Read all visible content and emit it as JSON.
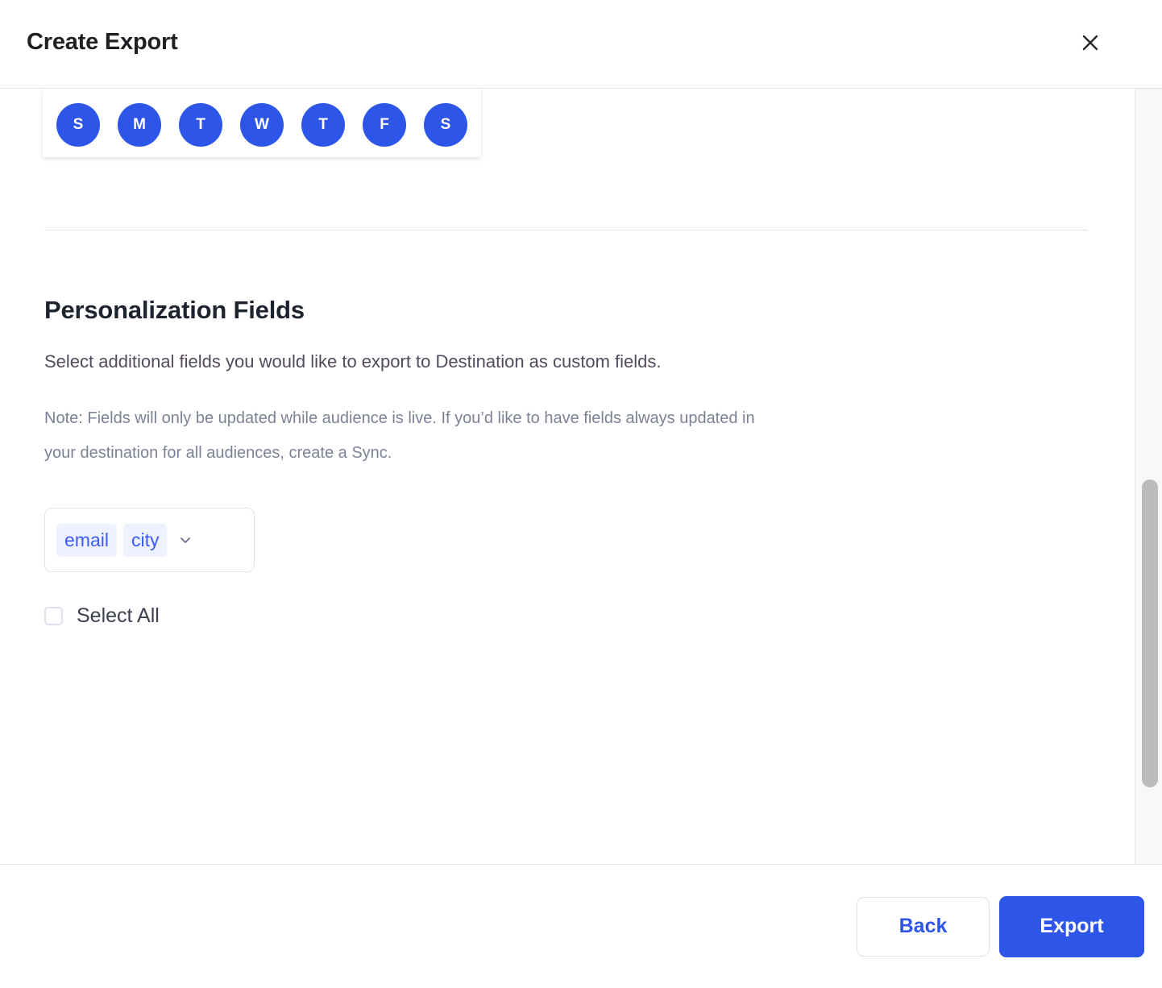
{
  "header": {
    "title": "Create Export",
    "close_icon": "close-icon"
  },
  "schedule": {
    "days": [
      {
        "label": "S",
        "name": "sunday"
      },
      {
        "label": "M",
        "name": "monday"
      },
      {
        "label": "T",
        "name": "tuesday"
      },
      {
        "label": "W",
        "name": "wednesday"
      },
      {
        "label": "T",
        "name": "thursday"
      },
      {
        "label": "F",
        "name": "friday"
      },
      {
        "label": "S",
        "name": "saturday"
      }
    ],
    "selected_color": "#2d55e8"
  },
  "personalization": {
    "title": "Personalization Fields",
    "subtitle": "Select additional fields you would like to export to Destination as custom fields.",
    "note": "Note: Fields will only be updated while audience is live. If you’d like to have fields always updated in your destination for all audiences, create a Sync.",
    "selected_fields": [
      "email",
      "city"
    ],
    "dropdown_icon": "chevron-down-icon",
    "select_all_label": "Select All",
    "select_all_checked": false,
    "chip_bg": "#eef2fe",
    "chip_text_color": "#3b5bfd"
  },
  "footer": {
    "back_label": "Back",
    "export_label": "Export",
    "primary_color": "#2d55e8"
  }
}
